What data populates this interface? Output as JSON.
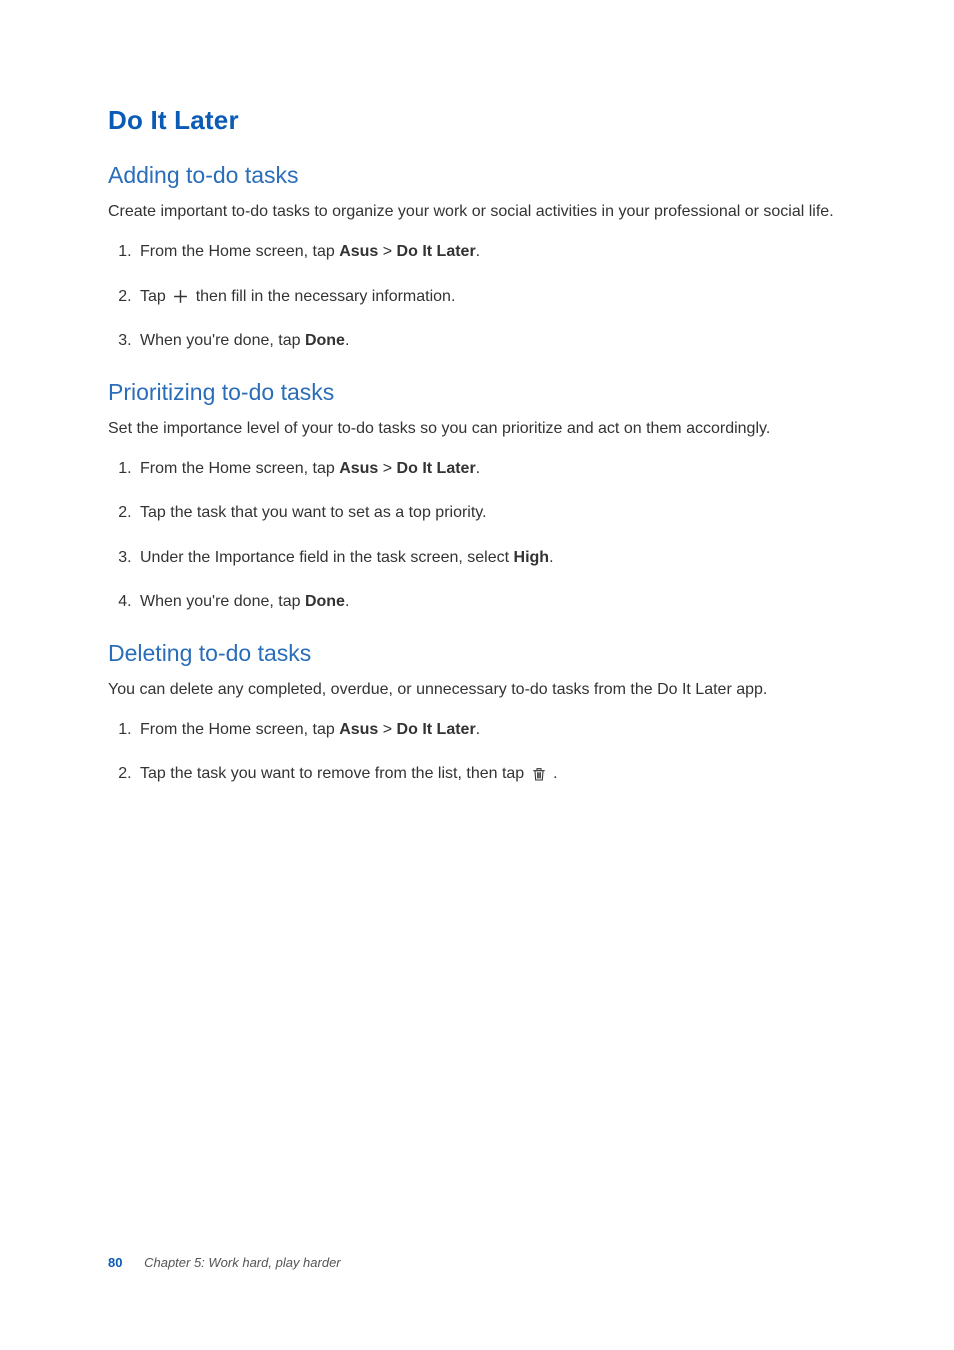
{
  "title": "Do It Later",
  "sections": [
    {
      "heading": "Adding to-do tasks",
      "intro": "Create important to-do tasks to organize your work or social activities in your professional or social life.",
      "steps": [
        {
          "prefix": "From the Home screen, tap ",
          "b1": "Asus",
          "mid": " > ",
          "b2": "Do It Later",
          "suffix": "."
        },
        {
          "prefix": "Tap ",
          "icon": "plus",
          "suffix": " then fill in the necessary information."
        },
        {
          "prefix": "When you're done, tap ",
          "b1": "Done",
          "suffix": "."
        }
      ]
    },
    {
      "heading": "Prioritizing to-do tasks",
      "intro": "Set the importance level of your to-do tasks so you can prioritize and act on them accordingly.",
      "steps": [
        {
          "prefix": "From the Home screen, tap ",
          "b1": "Asus",
          "mid": " > ",
          "b2": "Do It Later",
          "suffix": "."
        },
        {
          "prefix": "Tap the task that you want to set as a top priority."
        },
        {
          "prefix": "Under the Importance field in the task screen, select ",
          "b1": "High",
          "suffix": "."
        },
        {
          "prefix": "When you're done, tap ",
          "b1": "Done",
          "suffix": "."
        }
      ]
    },
    {
      "heading": "Deleting to-do tasks",
      "intro": "You can delete any completed, overdue, or unnecessary to-do tasks from the Do It Later app.",
      "steps": [
        {
          "prefix": "From the Home screen, tap ",
          "b1": "Asus",
          "mid": " > ",
          "b2": "Do It Later",
          "suffix": "."
        },
        {
          "prefix": "Tap the task you want to remove from the list, then tap ",
          "icon": "trash",
          "suffix": " ."
        }
      ]
    }
  ],
  "footer": {
    "page": "80",
    "chapter": "Chapter 5: Work hard, play harder"
  }
}
